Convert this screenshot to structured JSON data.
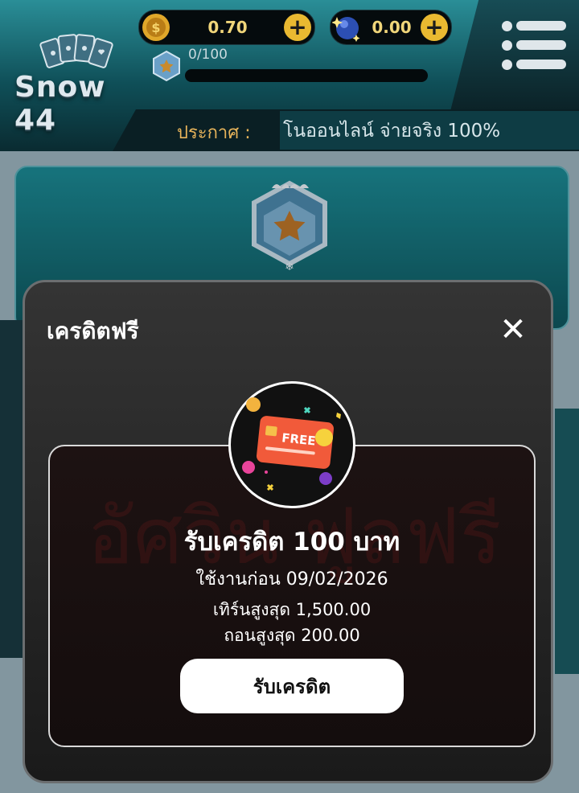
{
  "header": {
    "logo_text": "Snow 44",
    "coin_balance": "0.70",
    "gem_balance": "0.00",
    "xp_label": "0/100",
    "xp_progress": 0,
    "add_symbol": "+"
  },
  "announcement": {
    "label": "ประกาศ :",
    "text": "โนออนไลน์ จ่ายจริง 100%"
  },
  "modal": {
    "title": "เครดิตฟรี",
    "close_symbol": "✕",
    "icon_text": "FREE",
    "bonus_title": "รับเครดิต 100 บาท",
    "valid_until": "ใช้งานก่อน 09/02/2026",
    "max_turnover": "เทิร์นสูงสุด 1,500.00",
    "max_withdraw": "ถอนสูงสุด 200.00",
    "claim_label": "รับเครดิต",
    "watermark": "อัศวิน ฟูลฟรี"
  },
  "colors": {
    "accent_gold": "#e9b931",
    "teal": "#1c8d98",
    "card_red": "#f15a3a"
  }
}
